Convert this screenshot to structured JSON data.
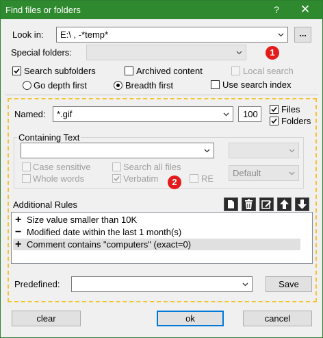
{
  "window": {
    "title": "Find files or folders",
    "help_label": "?",
    "close_label": "✕"
  },
  "top": {
    "look_in_label": "Look in:",
    "look_in_value": "E:\\ , -*temp*",
    "browse_label": "...",
    "special_folders_label": "Special folders:",
    "special_folders_value": "",
    "search_subfolders": {
      "label": "Search subfolders",
      "checked": true
    },
    "archived_content": {
      "label": "Archived content",
      "checked": false
    },
    "local_search": {
      "label": "Local search",
      "checked": false,
      "enabled": false
    },
    "go_depth_first": {
      "label": "Go depth first",
      "selected": false
    },
    "breadth_first": {
      "label": "Breadth first",
      "selected": true
    },
    "use_search_index": {
      "label": "Use search index",
      "checked": false
    }
  },
  "badges": {
    "one": "1",
    "two": "2"
  },
  "named": {
    "label": "Named:",
    "value": "*.gif",
    "count": "100",
    "files": {
      "label": "Files",
      "checked": true
    },
    "folders": {
      "label": "Folders",
      "checked": true
    }
  },
  "containing": {
    "label": "Containing Text",
    "value": "",
    "encoding_value": "",
    "mode_value": "Default",
    "case_sensitive": {
      "label": "Case sensitive",
      "checked": false
    },
    "search_all_files": {
      "label": "Search all files",
      "checked": false
    },
    "whole_words": {
      "label": "Whole words",
      "checked": false
    },
    "verbatim": {
      "label": "Verbatim",
      "checked": true
    },
    "re": {
      "label": "RE",
      "checked": false
    }
  },
  "rules": {
    "label": "Additional Rules",
    "toolbar_icons": [
      "new-icon",
      "delete-icon",
      "edit-icon",
      "up-arrow-icon",
      "down-arrow-icon"
    ],
    "items": [
      {
        "icon": "+",
        "text": "Size value smaller than 10K"
      },
      {
        "icon": "−",
        "text": "Modified date within the last 1 month(s)"
      },
      {
        "icon": "+",
        "text": "Comment contains \"computers\" (exact=0)"
      }
    ]
  },
  "predefined": {
    "label": "Predefined:",
    "value": "",
    "save_label": "Save"
  },
  "footer": {
    "clear_label": "clear",
    "ok_label": "ok",
    "cancel_label": "cancel"
  },
  "colors": {
    "titlebar": "#2f8a2f",
    "badge": "#e31b1b",
    "dashed_border": "#f4c430",
    "default_button": "#0078d7"
  }
}
